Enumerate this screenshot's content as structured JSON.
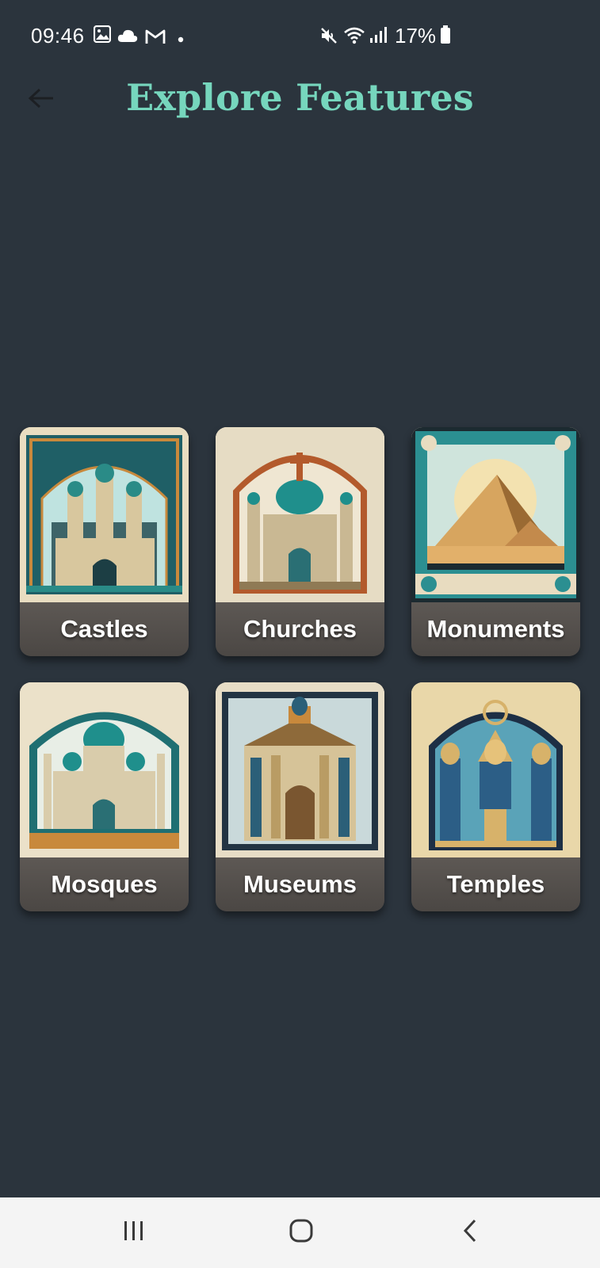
{
  "status_bar": {
    "time": "09:46",
    "battery_percent": "17%",
    "icons": [
      "gallery-icon",
      "cloud-icon",
      "gmail-icon",
      "dot-icon",
      "mute-icon",
      "wifi-icon",
      "signal-icon",
      "battery-icon"
    ]
  },
  "header": {
    "title": "Explore Features",
    "back_icon": "arrow-left-icon"
  },
  "colors": {
    "background": "#2b343d",
    "title": "#76d6bd",
    "card_label_text": "#ffffff",
    "navbar": "#f4f4f4"
  },
  "categories": [
    {
      "label": "Castles"
    },
    {
      "label": "Churches"
    },
    {
      "label": "Monuments"
    },
    {
      "label": "Mosques"
    },
    {
      "label": "Museums"
    },
    {
      "label": "Temples"
    }
  ],
  "nav_bar": {
    "buttons": [
      "recent-apps-icon",
      "home-icon",
      "back-icon"
    ]
  }
}
